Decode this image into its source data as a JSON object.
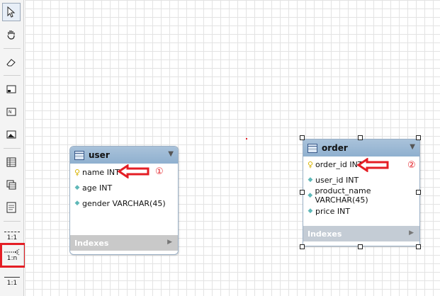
{
  "toolbar": {
    "tools": [
      {
        "name": "pointer-icon"
      },
      {
        "name": "hand-icon"
      },
      {
        "name": "eraser-icon"
      },
      {
        "name": "layer-icon"
      },
      {
        "name": "note-icon"
      },
      {
        "name": "image-icon"
      },
      {
        "name": "new-table-icon"
      },
      {
        "name": "new-view-icon"
      },
      {
        "name": "new-routine-icon"
      }
    ],
    "relations": [
      {
        "label": "1:1"
      },
      {
        "label": "1:n"
      },
      {
        "label": "1:1"
      }
    ]
  },
  "tables": {
    "user": {
      "title": "user",
      "columns": [
        {
          "label": "name INT"
        },
        {
          "label": "age INT"
        },
        {
          "label": "gender VARCHAR(45)"
        }
      ],
      "indexes_label": "Indexes"
    },
    "order": {
      "title": "order",
      "columns": [
        {
          "label": "order_id INT"
        },
        {
          "label": "user_id INT"
        },
        {
          "label": "product_name VARCHAR(45)"
        },
        {
          "label": "price INT"
        }
      ],
      "indexes_label": "Indexes"
    }
  },
  "annotations": {
    "marker_1": "①",
    "marker_2": "②"
  },
  "colors": {
    "accent_red": "#e41e25",
    "header_blue": "#8fb0cf"
  }
}
